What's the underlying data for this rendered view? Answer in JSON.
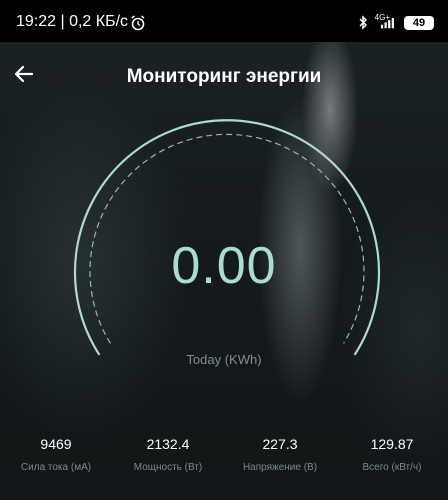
{
  "status_bar": {
    "time_speed": "19:22 | 0,2 КБ/с",
    "network": "4G+",
    "battery": "49",
    "icons": [
      "alarm-icon",
      "bluetooth-icon",
      "signal-icon",
      "battery-icon"
    ]
  },
  "header": {
    "title": "Мониторинг энергии",
    "back_icon": "back-arrow-icon"
  },
  "gauge": {
    "value": "0.00",
    "label": "Today (KWh)",
    "color": "#a9dcd2"
  },
  "stats": [
    {
      "value": "9469",
      "label": "Сила тока (мА)"
    },
    {
      "value": "2132.4",
      "label": "Мощность (Вт)"
    },
    {
      "value": "227.3",
      "label": "Напряжение (В)"
    },
    {
      "value": "129.87",
      "label": "Всего (кВт/ч)"
    }
  ]
}
